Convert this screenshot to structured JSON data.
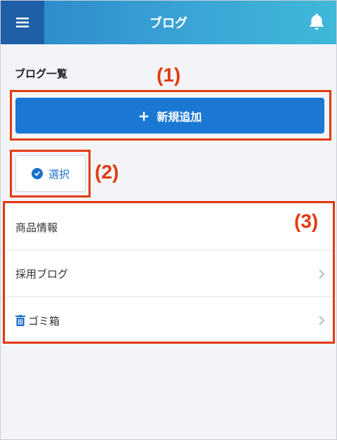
{
  "header": {
    "title": "ブログ",
    "menu_icon": "hamburger-icon",
    "bell_icon": "bell-icon",
    "menu_bg": "#1f5fa8",
    "gradient": [
      "#2b86c9",
      "#3fb8d8"
    ]
  },
  "section": {
    "title": "ブログ一覧"
  },
  "actions": {
    "add_label": "新規追加",
    "add_icon": "plus-icon",
    "select_label": "選択",
    "select_icon": "check-circle-icon",
    "accent": "#1a78d4"
  },
  "list": {
    "items": [
      {
        "label": "商品情報",
        "icon": null,
        "chevron": false
      },
      {
        "label": "採用ブログ",
        "icon": null,
        "chevron": true
      },
      {
        "label": "ゴミ箱",
        "icon": "trash-icon",
        "chevron": true
      }
    ]
  },
  "annotations": {
    "label_1": "(1)",
    "label_2": "(2)",
    "label_3": "(3)",
    "color": "#e23a12"
  }
}
